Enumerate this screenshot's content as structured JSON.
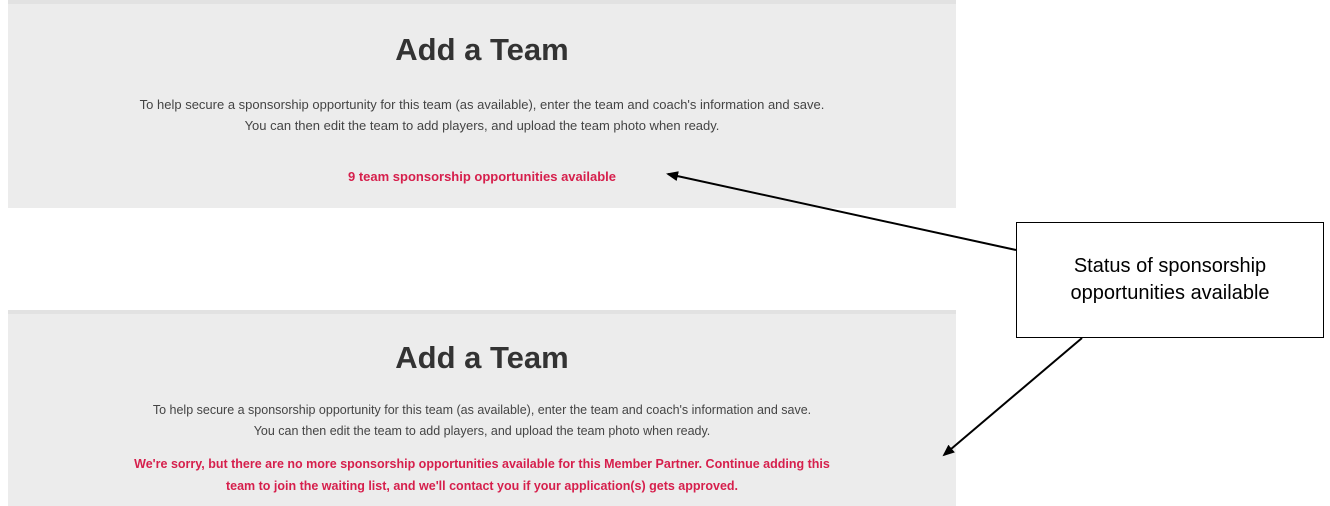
{
  "top_panel": {
    "title": "Add a Team",
    "description_line1": "To help secure a sponsorship opportunity for this team (as available), enter the team and coach's information and save.",
    "description_line2": "You can then edit the team to add players, and upload the team photo when ready.",
    "status": "9 team sponsorship opportunities available"
  },
  "bottom_panel": {
    "title": "Add a Team",
    "description_line1": "To help secure a sponsorship opportunity for this team (as available), enter the team and coach's information and save.",
    "description_line2": "You can then edit the team to add players, and upload the team photo when ready.",
    "status_line1": "We're sorry, but there are no more sponsorship opportunities available for this Member Partner. Continue adding this",
    "status_line2": "team to join the waiting list, and we'll contact you if your application(s) gets approved."
  },
  "callout": {
    "line1": "Status of sponsorship",
    "line2": "opportunities available"
  },
  "colors": {
    "panel_background": "#ececec",
    "status_red": "#d61f4c",
    "title_text": "#333333"
  }
}
